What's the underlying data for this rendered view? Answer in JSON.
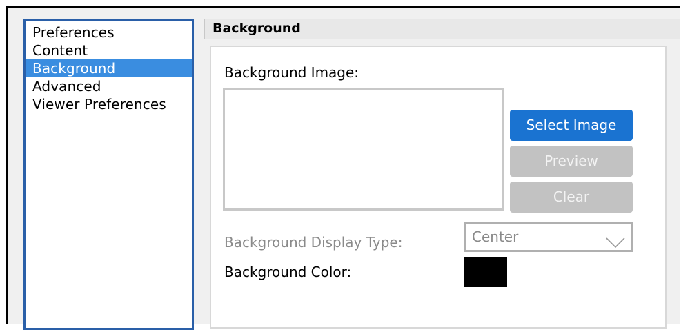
{
  "nav": {
    "items": [
      {
        "label": "Preferences",
        "selected": false
      },
      {
        "label": "Content",
        "selected": false
      },
      {
        "label": "Background",
        "selected": true
      },
      {
        "label": "Advanced",
        "selected": false
      },
      {
        "label": "Viewer Preferences",
        "selected": false
      }
    ]
  },
  "section": {
    "title": "Background"
  },
  "background_image": {
    "label": "Background Image:",
    "buttons": {
      "select": "Select Image",
      "preview": "Preview",
      "clear": "Clear"
    }
  },
  "display_type": {
    "label": "Background Display Type:",
    "value": "Center",
    "icon": "chevron-down-icon"
  },
  "color": {
    "label": "Background Color:",
    "value": "#000000"
  },
  "colors": {
    "selected_item": "#3a8de0",
    "primary_button": "#1a73d1",
    "disabled_button": "#c2c2c2"
  }
}
